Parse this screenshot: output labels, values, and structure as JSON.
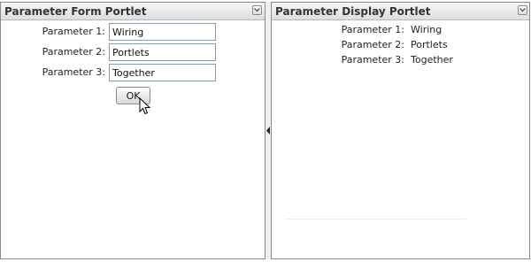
{
  "form_portlet": {
    "title": "Parameter Form Portlet",
    "menu_icon": "chevron-down-icon",
    "fields": [
      {
        "label": "Parameter 1:",
        "value": "Wiring"
      },
      {
        "label": "Parameter 2:",
        "value": "Portlets"
      },
      {
        "label": "Parameter 3:",
        "value": "Together"
      }
    ],
    "ok_label": "OK"
  },
  "display_portlet": {
    "title": "Parameter Display Portlet",
    "menu_icon": "chevron-down-icon",
    "rows": [
      {
        "label": "Parameter 1:",
        "value": "Wiring"
      },
      {
        "label": "Parameter 2:",
        "value": "Portlets"
      },
      {
        "label": "Parameter 3:",
        "value": "Together"
      }
    ]
  },
  "splitter": {
    "icon": "collapse-left-arrow-icon"
  },
  "cursor": {
    "icon": "mouse-pointer-icon"
  },
  "colors": {
    "titlebar_top": "#f7f7f7",
    "titlebar_bottom": "#dedede",
    "border": "#8a8a8a",
    "input_border": "#7f9db9"
  }
}
